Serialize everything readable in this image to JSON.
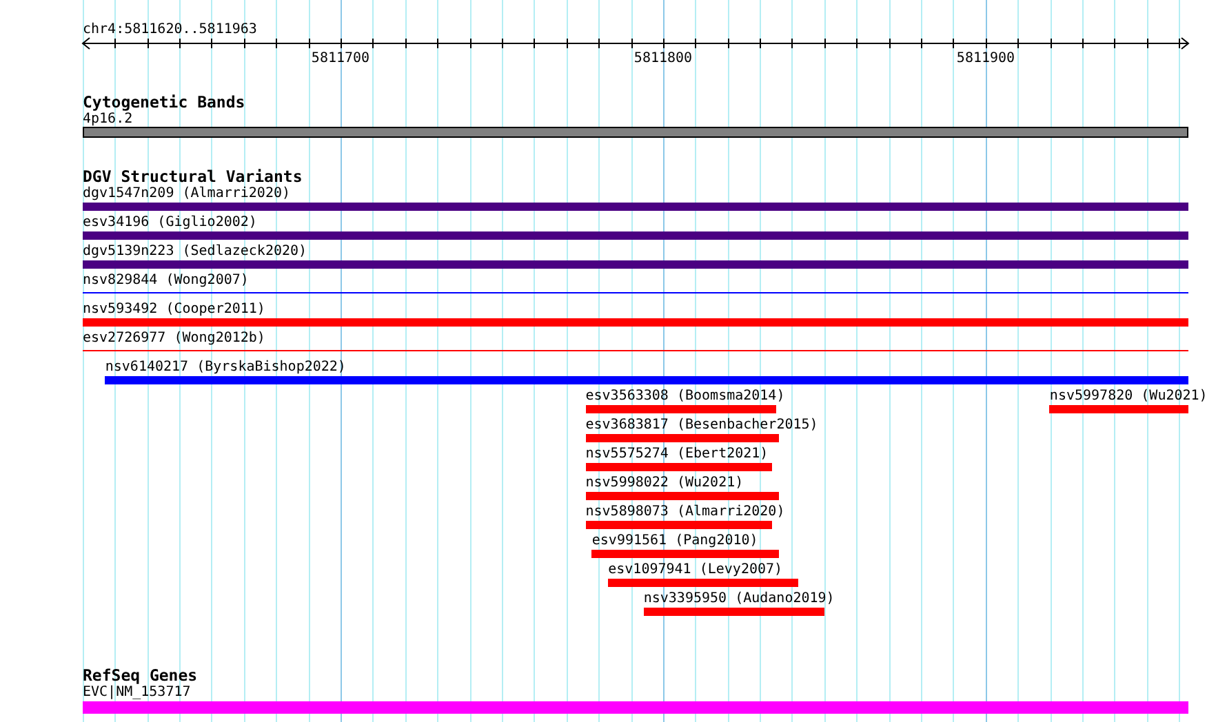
{
  "ruler": {
    "label": "chr4:5811620..5811963",
    "major_ticks": [
      {
        "label": "5811700",
        "level": 0.2332
      },
      {
        "label": "5811800",
        "level": 0.5248
      },
      {
        "label": "5811900",
        "level": 0.8163
      }
    ]
  },
  "tracks": [
    {
      "title": "Cytogenetic Bands",
      "rows": [
        [
          {
            "label": "4p16.2",
            "kind": "band",
            "color": "#808080"
          }
        ]
      ]
    },
    {
      "title": "DGV Structural Variants",
      "rows": [
        [
          {
            "label": "dgv1547n209 (Almarri2020)",
            "kind": "bar",
            "color": "#4b0082"
          }
        ],
        [
          {
            "label": "esv34196 (Giglio2002)",
            "kind": "bar",
            "color": "#4b0082"
          }
        ],
        [
          {
            "label": "dgv5139n223 (Sedlazeck2020)",
            "kind": "bar",
            "color": "#4b0082"
          }
        ],
        [
          {
            "label": "nsv829844 (Wong2007)",
            "kind": "line",
            "color": "#0000ff"
          }
        ],
        [
          {
            "label": "nsv593492 (Cooper2011)",
            "kind": "bar",
            "color": "#ff0000"
          }
        ],
        [
          {
            "label": "esv2726977 (Wong2012b)",
            "kind": "line",
            "color": "#ff0000"
          }
        ],
        [
          {
            "label": "nsv6140217 (ByrskaBishop2022)",
            "kind": "bar",
            "color": "#0000ff"
          }
        ],
        [
          {
            "label": "esv3563308 (Boomsma2014)",
            "kind": "bar",
            "color": "#ff0000"
          },
          {
            "label": "nsv5997820 (Wu2021)",
            "kind": "bar",
            "color": "#ff0000"
          }
        ],
        [
          {
            "label": "esv3683817 (Besenbacher2015)",
            "kind": "bar",
            "color": "#ff0000"
          }
        ],
        [
          {
            "label": "nsv5575274 (Ebert2021)",
            "kind": "bar",
            "color": "#ff0000"
          }
        ],
        [
          {
            "label": "nsv5998022 (Wu2021)",
            "kind": "bar",
            "color": "#ff0000"
          }
        ],
        [
          {
            "label": "nsv5898073 (Almarri2020)",
            "kind": "bar",
            "color": "#ff0000"
          }
        ],
        [
          {
            "label": "esv991561 (Pang2010)",
            "kind": "bar",
            "color": "#ff0000"
          }
        ],
        [
          {
            "label": "esv1097941 (Levy2007)",
            "kind": "bar",
            "color": "#ff0000"
          }
        ],
        [
          {
            "label": "nsv3395950 (Audano2019)",
            "kind": "bar",
            "color": "#ff0000"
          }
        ]
      ]
    },
    {
      "title": "RefSeq Genes",
      "rows": [
        [
          {
            "label": "EVC|NM_153717",
            "kind": "gene",
            "color": "#ff00ff"
          }
        ]
      ]
    }
  ]
}
